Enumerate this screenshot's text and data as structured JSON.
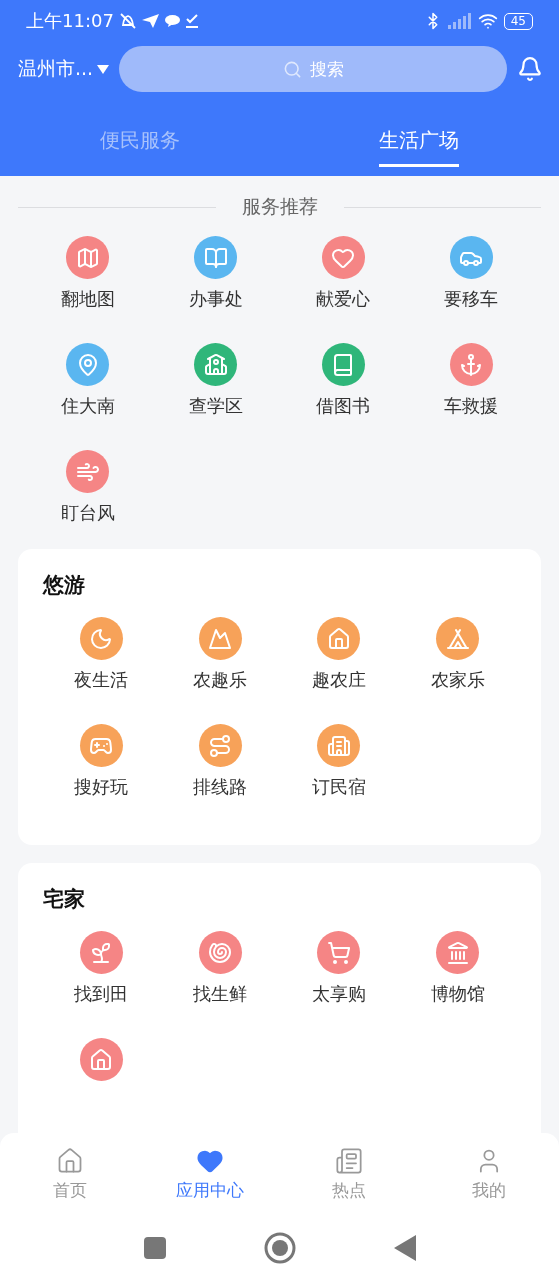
{
  "status_bar": {
    "time": "上午11:07",
    "battery": "45"
  },
  "header": {
    "city": "温州市...",
    "search": {
      "placeholder": "搜索"
    }
  },
  "tabs": [
    {
      "label": "便民服务",
      "selected": false
    },
    {
      "label": "生活广场",
      "selected": true
    }
  ],
  "recommended": {
    "title": "服务推荐",
    "items": [
      {
        "label": "翻地图",
        "color": "#f58585"
      },
      {
        "label": "办事处",
        "color": "#5ab6f0"
      },
      {
        "label": "献爱心",
        "color": "#f58585"
      },
      {
        "label": "要移车",
        "color": "#5ab6f0"
      },
      {
        "label": "住大南",
        "color": "#5ab6f0"
      },
      {
        "label": "查学区",
        "color": "#2fb67a"
      },
      {
        "label": "借图书",
        "color": "#2fb67a"
      },
      {
        "label": "车救援",
        "color": "#f58585"
      },
      {
        "label": "盯台风",
        "color": "#f58585"
      }
    ]
  },
  "sections": [
    {
      "title": "悠游",
      "items": [
        {
          "label": "夜生活",
          "color": "#f7a259"
        },
        {
          "label": "农趣乐",
          "color": "#f7a259"
        },
        {
          "label": "趣农庄",
          "color": "#f7a259"
        },
        {
          "label": "农家乐",
          "color": "#f7a259"
        },
        {
          "label": "搜好玩",
          "color": "#f7a259"
        },
        {
          "label": "排线路",
          "color": "#f7a259"
        },
        {
          "label": "订民宿",
          "color": "#f7a259"
        }
      ]
    },
    {
      "title": "宅家",
      "items": [
        {
          "label": "找到田",
          "color": "#f58585"
        },
        {
          "label": "找生鲜",
          "color": "#f58585"
        },
        {
          "label": "太享购",
          "color": "#f58585"
        },
        {
          "label": "博物馆",
          "color": "#f58585"
        },
        {
          "color": "#f58585"
        }
      ]
    }
  ],
  "bottom_nav": [
    {
      "label": "首页",
      "selected": false
    },
    {
      "label": "应用中心",
      "selected": true
    },
    {
      "label": "热点",
      "selected": false
    },
    {
      "label": "我的",
      "selected": false
    }
  ]
}
